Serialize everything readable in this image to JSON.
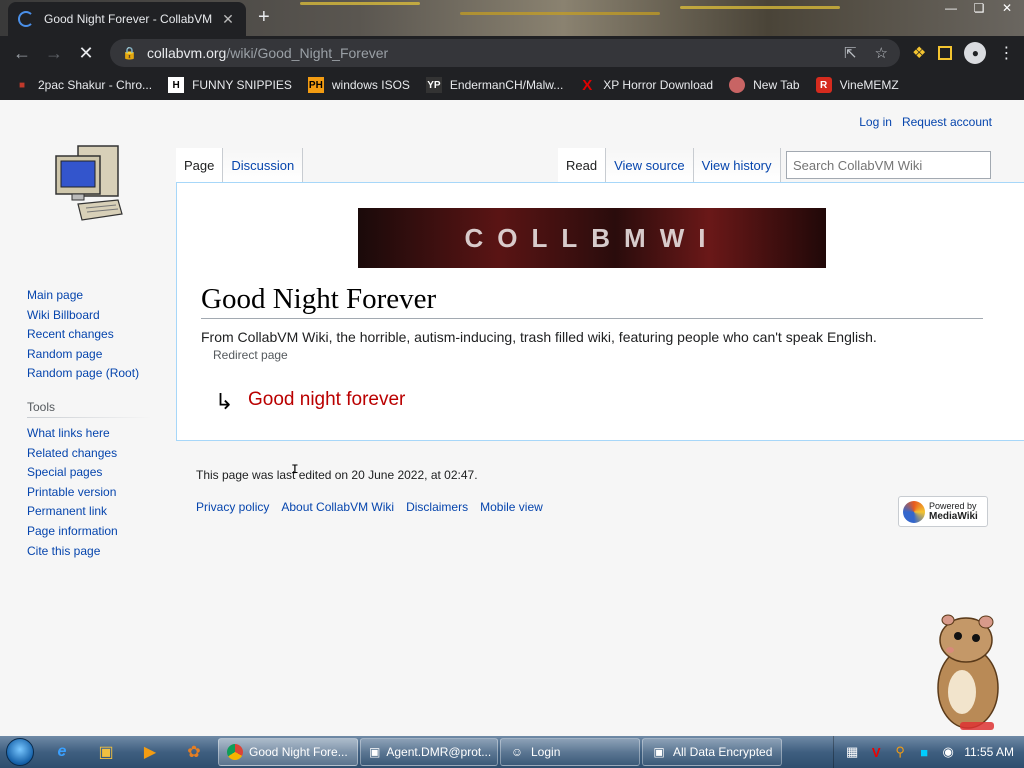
{
  "browser": {
    "tab_title": "Good Night Forever - CollabVM",
    "url_host": "collabvm.org",
    "url_path": "/wiki/Good_Night_Forever",
    "new_tab": "+",
    "tab_close": "✕"
  },
  "bookmarks": [
    {
      "label": "2pac Shakur - Chro...",
      "icon": "puzzle-icon",
      "color": "#c0392b"
    },
    {
      "label": "FUNNY SNIPPIES",
      "icon": "H",
      "color": "#ffffff"
    },
    {
      "label": "windows ISOS",
      "icon": "PH",
      "color": "#f39c12"
    },
    {
      "label": "EndermanCH/Malw...",
      "icon": "YP",
      "color": "#333333"
    },
    {
      "label": "XP Horror Download",
      "icon": "X",
      "color": "#e00000"
    },
    {
      "label": "New Tab",
      "icon": "globe-icon",
      "color": "#c86464"
    },
    {
      "label": "VineMEMZ",
      "icon": "R",
      "color": "#d52b1e"
    }
  ],
  "wiki": {
    "login": "Log in",
    "request_account": "Request account",
    "tab_page": "Page",
    "tab_discussion": "Discussion",
    "tab_read": "Read",
    "tab_view_source": "View source",
    "tab_view_history": "View history",
    "search_placeholder": "Search CollabVM Wiki",
    "banner_text": "COLLBMWI",
    "title": "Good Night Forever",
    "tagline": "From CollabVM Wiki, the horrible, autism-inducing, trash filled wiki, featuring people who can't speak English.",
    "redirect_note": "Redirect page",
    "redirect_arrow": "↳",
    "redirect_target": "Good night forever",
    "last_edited": "This page was last edited on 20 June 2022, at 02:47.",
    "footer_links": [
      "Privacy policy",
      "About CollabVM Wiki",
      "Disclaimers",
      "Mobile view"
    ],
    "powered_by_line1": "Powered by",
    "powered_by_line2": "MediaWiki",
    "nav": [
      "Main page",
      "Wiki Billboard",
      "Recent changes",
      "Random page",
      "Random page (Root)"
    ],
    "tools_heading": "Tools",
    "tools": [
      "What links here",
      "Related changes",
      "Special pages",
      "Printable version",
      "Permanent link",
      "Page information",
      "Cite this page"
    ]
  },
  "taskbar": {
    "tasks": [
      {
        "label": "Good Night Fore...",
        "icon": "chrome-icon",
        "active": true
      },
      {
        "label": "Agent.DMR@prot...",
        "icon": "window-icon",
        "active": false
      },
      {
        "label": "Login",
        "icon": "user-icon",
        "active": false
      },
      {
        "label": "All Data Encrypted",
        "icon": "window-icon",
        "active": false
      }
    ],
    "clock": "11:55 AM"
  },
  "colors": {
    "link": "#0645ad",
    "redlink": "#ba0000",
    "browser_dark": "#202124",
    "taskbar": "#3f5f80"
  }
}
